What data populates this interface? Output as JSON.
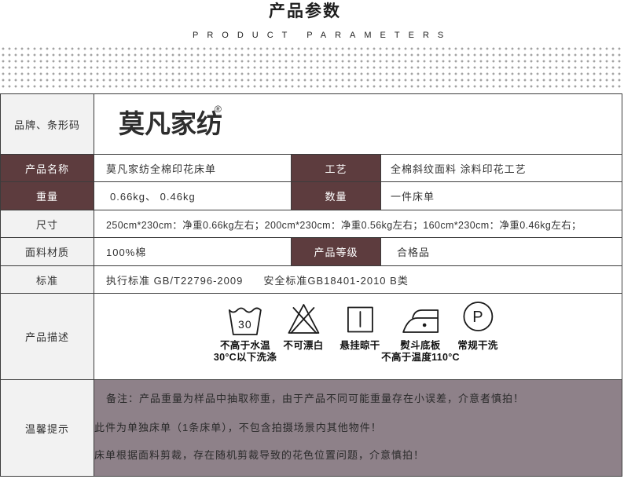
{
  "header": {
    "title": "产品参数",
    "subtitle": "PRODUCT PARAMETERS"
  },
  "brand": {
    "label": "品牌、条形码",
    "logo_text": "莫凡家纺",
    "registered_mark": "®"
  },
  "params": {
    "product_name": {
      "label": "产品名称",
      "value": "莫凡家纺全棉印花床单"
    },
    "craft": {
      "label": "工艺",
      "value": "全棉斜纹面料 涂料印花工艺"
    },
    "weight": {
      "label": "重量",
      "value": "0.66kg、 0.46kg"
    },
    "quantity": {
      "label": "数量",
      "value": "一件床单"
    },
    "size": {
      "label": "尺寸",
      "value": "250cm*230cm：净重0.66kg左右；200cm*230cm：净重0.56kg左右；160cm*230cm：净重0.46kg左右；"
    },
    "material": {
      "label": "面料材质",
      "value": "100%棉"
    },
    "grade": {
      "label": "产品等级",
      "value": "合格品"
    },
    "standard": {
      "label": "标准",
      "execution": "执行标准 GB/T22796-2009",
      "safety": "安全标准GB18401-2010 B类"
    }
  },
  "care": {
    "label": "产品描述",
    "items": [
      {
        "icon": "wash-30-icon",
        "symbol": "30",
        "caption": [
          "不高于水温",
          "30°C以下洗涤"
        ]
      },
      {
        "icon": "no-bleach-icon",
        "caption": [
          "不可漂白"
        ]
      },
      {
        "icon": "line-dry-icon",
        "caption": [
          "悬挂晾干"
        ]
      },
      {
        "icon": "iron-low-heat-icon",
        "caption": [
          "熨斗底板",
          "不高于温度110°C"
        ]
      },
      {
        "icon": "dry-clean-icon",
        "symbol": "P",
        "caption": [
          "常规干洗"
        ]
      }
    ]
  },
  "tips": {
    "label": "温馨提示",
    "lines": [
      "备注：产品重量为样品中抽取称重，由于产品不同可能重量存在小误差，介意者慎拍！",
      "此件为单独床单（1条床单），不包含拍摄场景内其他物件！",
      "床单根据面料剪裁，存在随机剪裁导致的花色位置问题，介意慎拍！"
    ]
  },
  "colors": {
    "dark_label_bg": "#5d3c3e",
    "dark_label_text": "#ffffff",
    "light_label_bg": "#f2f2f2",
    "tips_bg": "#8e8189",
    "border": "#3c3c3c",
    "text": "#333333"
  }
}
